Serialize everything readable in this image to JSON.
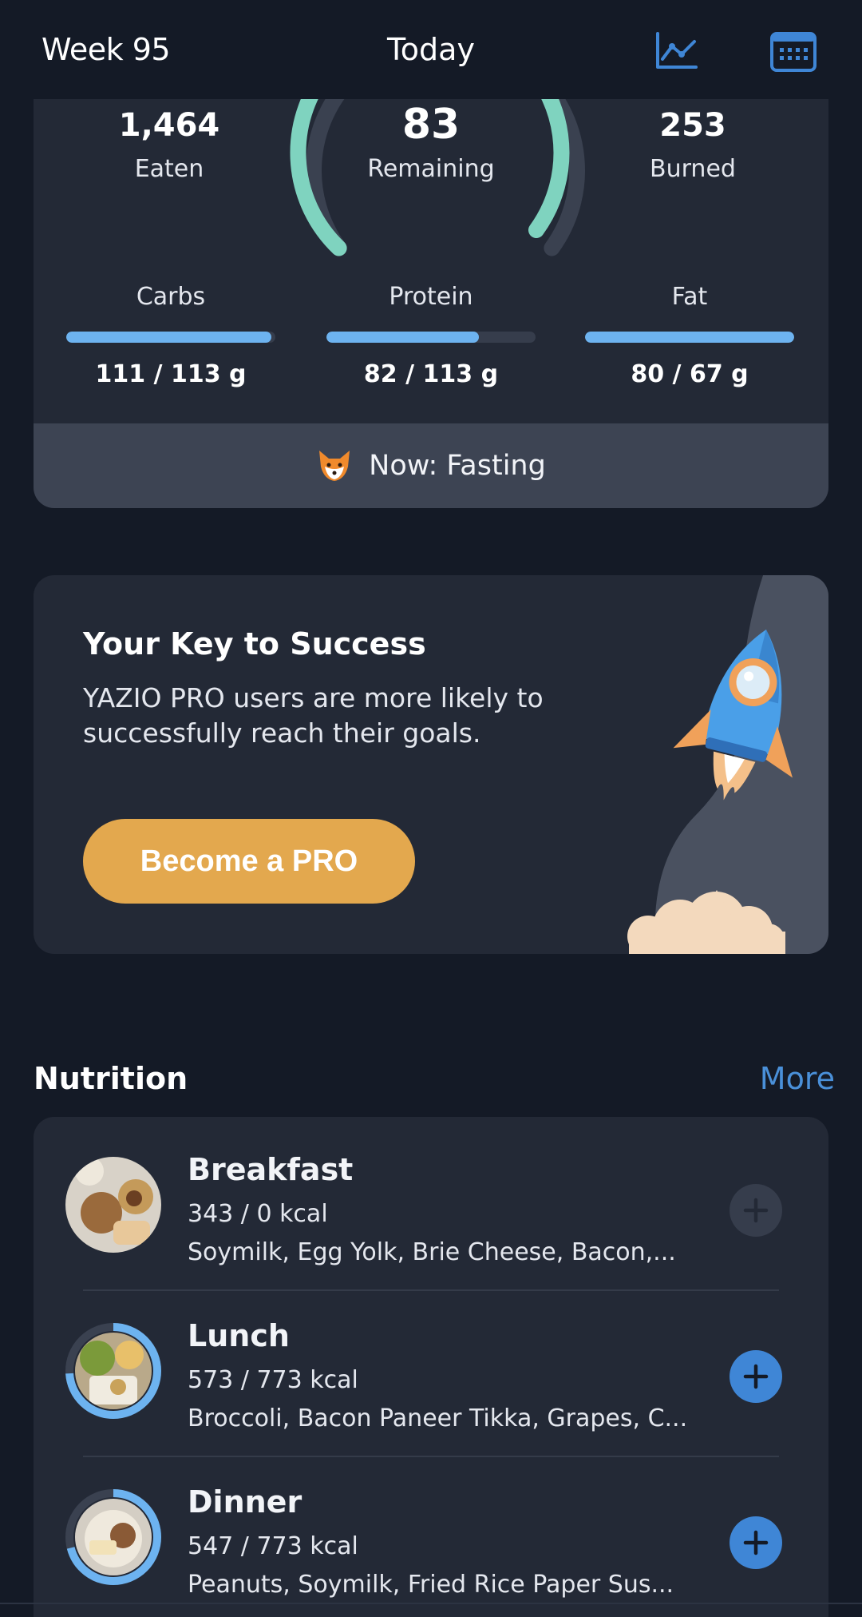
{
  "header": {
    "week_label": "Week 95",
    "title": "Today",
    "chart_icon": "line-chart-icon",
    "calendar_icon": "calendar-icon"
  },
  "summary": {
    "eaten_value": "1,464",
    "eaten_label": "Eaten",
    "remaining_value": "83",
    "remaining_label": "Remaining",
    "burned_value": "253",
    "burned_label": "Burned",
    "ring_color": "#7fd3bf",
    "macros": [
      {
        "label": "Carbs",
        "value": "111 / 113 g",
        "progress": 0.98
      },
      {
        "label": "Protein",
        "value": "82 / 113 g",
        "progress": 0.73
      },
      {
        "label": "Fat",
        "value": "80 / 67 g",
        "progress": 1.0
      }
    ],
    "fasting_text": "Now: Fasting",
    "fasting_icon": "fox-icon"
  },
  "promo": {
    "title": "Your Key to Success",
    "text": "YAZIO PRO users are more likely to successfully reach their goals.",
    "button_label": "Become a PRO",
    "illustration": "rocket-illustration",
    "button_color": "#e3a84e"
  },
  "nutrition": {
    "title": "Nutrition",
    "more_label": "More",
    "meals": [
      {
        "name": "Breakfast",
        "kcal": "343 / 0 kcal",
        "foods": "Soymilk, Egg Yolk, Brie Cheese, Bacon,...",
        "progress": 0
      },
      {
        "name": "Lunch",
        "kcal": "573 / 773 kcal",
        "foods": "Broccoli, Bacon Paneer Tikka, Grapes, C...",
        "progress": 0.74
      },
      {
        "name": "Dinner",
        "kcal": "547 / 773 kcal",
        "foods": "Peanuts, Soymilk, Fried Rice Paper Sus...",
        "progress": 0.71
      }
    ]
  },
  "colors": {
    "background": "#141a26",
    "card": "#232936",
    "accent_blue": "#3f86d6",
    "bar_blue": "#6db3f0"
  }
}
